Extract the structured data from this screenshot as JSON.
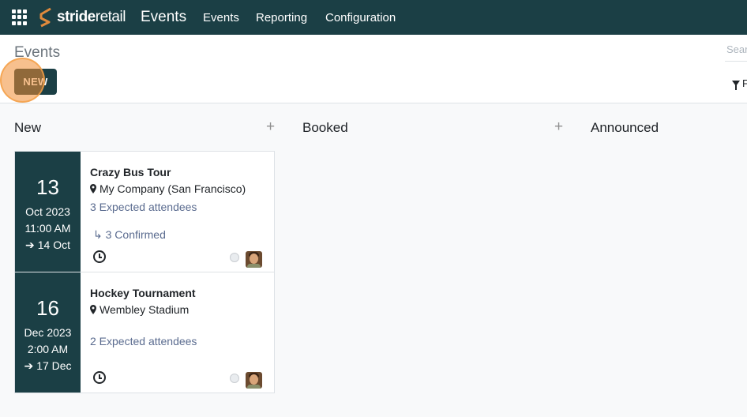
{
  "topbar": {
    "brand_bold": "stride",
    "brand_light": "retail",
    "app_title": "Events",
    "menu": [
      "Events",
      "Reporting",
      "Configuration"
    ]
  },
  "control": {
    "breadcrumb": "Events",
    "new_label": "NEW",
    "search_placeholder": "Sear",
    "filter_label": "F"
  },
  "columns": [
    {
      "title": "New",
      "add": "+"
    },
    {
      "title": "Booked",
      "add": "+"
    },
    {
      "title": "Announced"
    }
  ],
  "cards": [
    {
      "day": "13",
      "month": "Oct 2023",
      "time": "11:00 AM",
      "end": "14 Oct",
      "title": "Crazy Bus Tour",
      "location": "My Company (San Francisco)",
      "attendees": "3 Expected attendees",
      "confirmed": "3 Confirmed"
    },
    {
      "day": "16",
      "month": "Dec 2023",
      "time": "2:00 AM",
      "end": "17 Dec",
      "title": "Hockey Tournament",
      "location": "Wembley Stadium",
      "attendees": "2 Expected attendees"
    }
  ],
  "colors": {
    "primary": "#1b3f45",
    "accent": "#f08c32",
    "link": "#5a6b8f"
  },
  "icons": [
    "apps-grid-icon",
    "stride-logo-icon",
    "filter-icon",
    "map-marker-icon",
    "arrow-right-icon",
    "reply-arrow-icon",
    "clock-icon"
  ]
}
